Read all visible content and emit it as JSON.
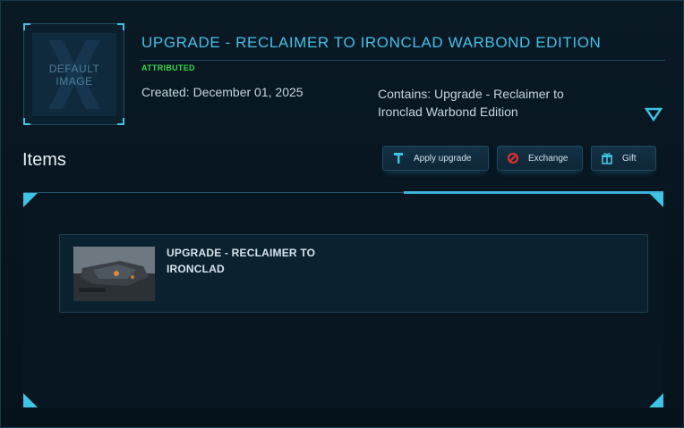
{
  "header": {
    "thumbnail_text": "DEFAULT IMAGE",
    "title": "UPGRADE - RECLAIMER TO IRONCLAD WARBOND EDITION",
    "badge": "ATTRIBUTED",
    "created": "Created: December 01, 2025",
    "contains": "Contains: Upgrade - Reclaimer to Ironclad Warbond Edition"
  },
  "items_section": {
    "label": "Items",
    "buttons": {
      "apply_upgrade": "Apply upgrade",
      "exchange": "Exchange",
      "gift": "Gift"
    }
  },
  "items": [
    {
      "name": "UPGRADE - RECLAIMER TO IRONCLAD"
    }
  ],
  "colors": {
    "accent": "#46bfe8",
    "badge_green": "#36d84a",
    "background": "#051118"
  },
  "icons": {
    "apply": "hammer-icon",
    "exchange": "prohibited-icon",
    "gift": "gift-box-icon",
    "collapse": "chevron-down-icon"
  }
}
